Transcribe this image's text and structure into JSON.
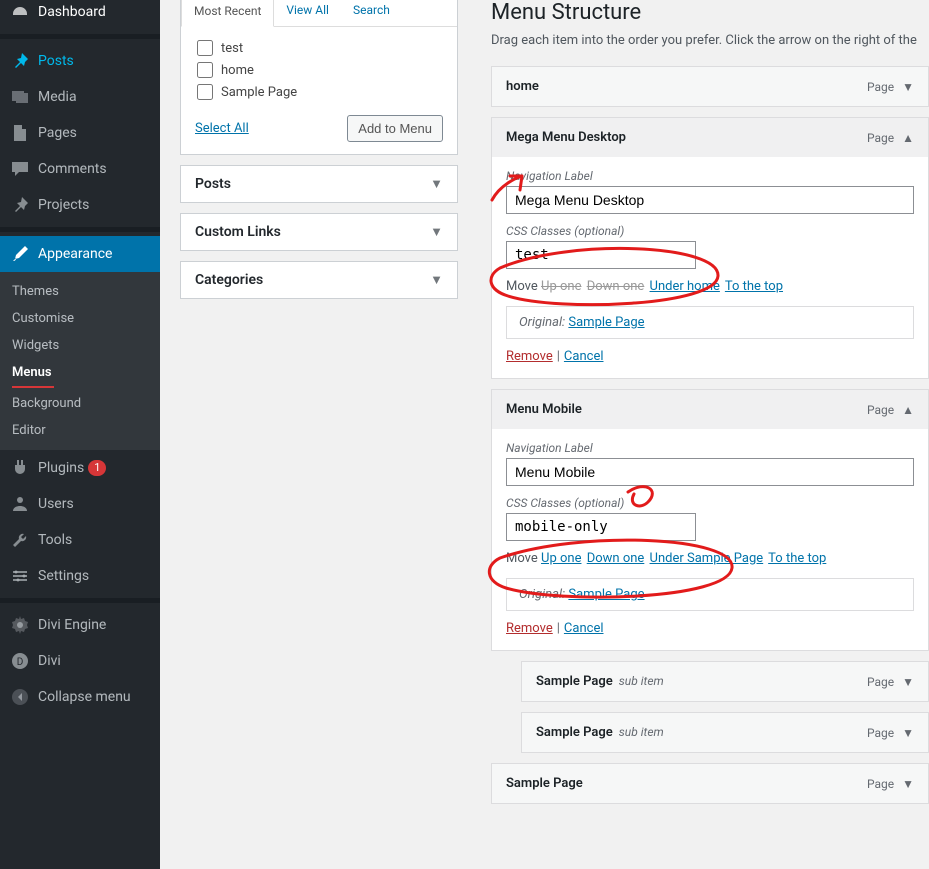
{
  "sidebar": {
    "dashboard": "Dashboard",
    "posts": "Posts",
    "media": "Media",
    "pages": "Pages",
    "comments": "Comments",
    "projects": "Projects",
    "appearance": "Appearance",
    "appearance_sub": {
      "themes": "Themes",
      "customise": "Customise",
      "widgets": "Widgets",
      "menus": "Menus",
      "background": "Background",
      "editor": "Editor"
    },
    "plugins": "Plugins",
    "plugins_badge": "1",
    "users": "Users",
    "tools": "Tools",
    "settings": "Settings",
    "divi_engine": "Divi Engine",
    "divi": "Divi",
    "collapse": "Collapse menu"
  },
  "pages_panel": {
    "tabs": {
      "recent": "Most Recent",
      "view_all": "View All",
      "search": "Search"
    },
    "items": [
      "test",
      "home",
      "Sample Page"
    ],
    "select_all": "Select All",
    "add_btn": "Add to Menu"
  },
  "closed_panels": {
    "posts": "Posts",
    "custom_links": "Custom Links",
    "categories": "Categories"
  },
  "structure": {
    "title": "Menu Structure",
    "helper": "Drag each item into the order you prefer. Click the arrow on the right of the",
    "labels": {
      "page": "Page",
      "nav_label": "Navigation Label",
      "css_classes": "CSS Classes (optional)",
      "move": "Move",
      "up_one": "Up one",
      "down_one": "Down one",
      "under_home": "Under home",
      "under_sample": "Under Sample Page",
      "to_top": "To the top",
      "original": "Original:",
      "sample_page": "Sample Page",
      "remove": "Remove",
      "cancel": "Cancel",
      "sub_item": "sub item"
    },
    "items": {
      "home": {
        "title": "home"
      },
      "mega": {
        "title": "Mega Menu Desktop",
        "nav_label_val": "Mega Menu Desktop",
        "css_val": "test"
      },
      "mobile": {
        "title": "Menu Mobile",
        "nav_label_val": "Menu Mobile",
        "css_val": "mobile-only"
      },
      "sample1": {
        "title": "Sample Page"
      },
      "sample2": {
        "title": "Sample Page"
      },
      "sample3": {
        "title": "Sample Page"
      }
    }
  }
}
